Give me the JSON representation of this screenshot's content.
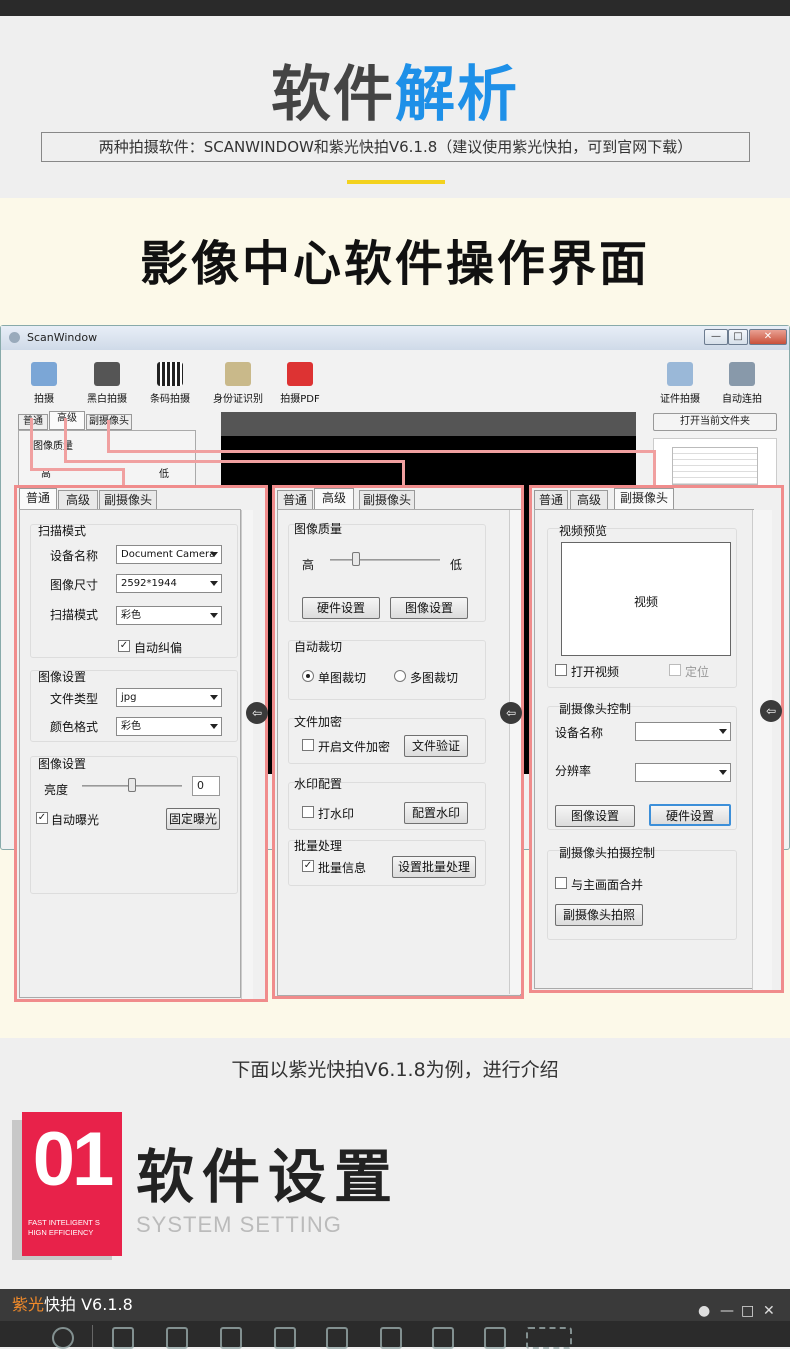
{
  "hero": {
    "title_a": "软件",
    "title_b": "解析",
    "subtitle": "两种拍摄软件：SCANWINDOW和紫光快拍V6.1.8（建议使用紫光快拍，可到官网下载）"
  },
  "section_title": "影像中心软件操作界面",
  "scanwindow": {
    "title": "ScanWindow",
    "window_buttons": [
      "—",
      "□",
      "✕"
    ],
    "toolbar": [
      "拍摄",
      "黑白拍摄",
      "条码拍摄",
      "身份证识别",
      "拍摄PDF",
      "证件拍摄",
      "自动连拍"
    ],
    "tabs": [
      "普通",
      "高级",
      "副摄像头"
    ],
    "inner_group": "图像质量",
    "inner_high": "高",
    "inner_low": "低",
    "open_folder": "打开当前文件夹"
  },
  "panel_normal": {
    "tabs": [
      "普通",
      "高级",
      "副摄像头"
    ],
    "scan_mode_title": "扫描模式",
    "device_label": "设备名称",
    "device_value": "Document Camera",
    "size_label": "图像尺寸",
    "size_value": "2592*1944",
    "mode_label": "扫描模式",
    "mode_value": "彩色",
    "auto_correct": "自动纠偏",
    "img_settings_title": "图像设置",
    "filetype_label": "文件类型",
    "filetype_value": "jpg",
    "color_label": "颜色格式",
    "color_value": "彩色",
    "img_settings2_title": "图像设置",
    "brightness_label": "亮度",
    "brightness_value": "0",
    "auto_exposure": "自动曝光",
    "fixed_exposure": "固定曝光"
  },
  "panel_advanced": {
    "tabs": [
      "普通",
      "高级",
      "副摄像头"
    ],
    "quality_title": "图像质量",
    "high": "高",
    "low": "低",
    "hw_settings": "硬件设置",
    "img_settings": "图像设置",
    "crop_title": "自动裁切",
    "single_crop": "单图裁切",
    "multi_crop": "多图裁切",
    "encrypt_title": "文件加密",
    "enable_encrypt": "开启文件加密",
    "verify_file": "文件验证",
    "watermark_title": "水印配置",
    "watermark": "打水印",
    "config_watermark": "配置水印",
    "batch_title": "批量处理",
    "batch_info": "批量信息",
    "set_batch": "设置批量处理"
  },
  "panel_sub": {
    "tabs": [
      "普通",
      "高级",
      "副摄像头"
    ],
    "preview_title": "视频预览",
    "video": "视频",
    "open_video": "打开视频",
    "locate": "定位",
    "control_title": "副摄像头控制",
    "device_label": "设备名称",
    "resolution_label": "分辨率",
    "img_settings": "图像设置",
    "hw_settings": "硬件设置",
    "capture_title": "副摄像头拍摄控制",
    "merge_main": "与主画面合并",
    "sub_capture": "副摄像头拍照"
  },
  "intro": "下面以紫光快拍V6.1.8为例，进行介绍",
  "section01": {
    "number": "01",
    "tagline_1": "FAST INTELIGENT S",
    "tagline_2": "HIGN EFFICIENCY",
    "title": "软件设置",
    "subtitle": "SYSTEM SETTING"
  },
  "zg": {
    "title_a": "紫光",
    "title_b": "快拍 V6.1.8",
    "controls": [
      "●",
      "—",
      "□",
      "✕"
    ]
  }
}
